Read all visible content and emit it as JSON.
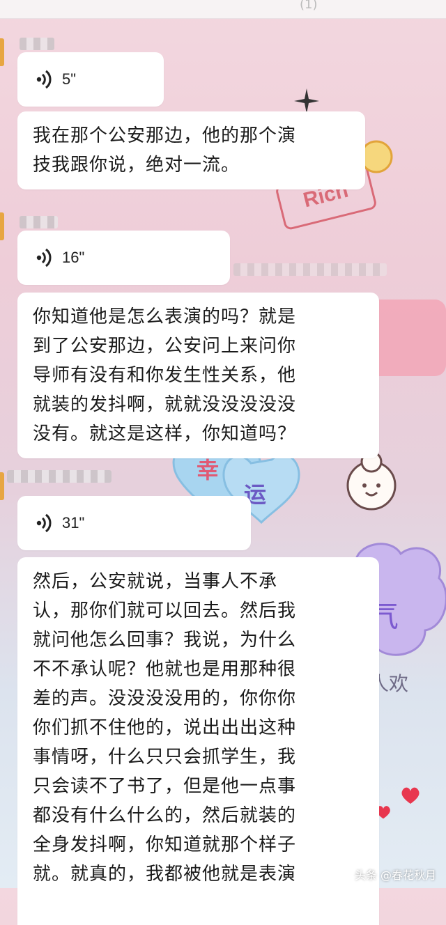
{
  "header": {
    "title": "(1)"
  },
  "messages": [
    {
      "type": "voice",
      "duration": "5\""
    },
    {
      "type": "text",
      "lines": [
        "我在那个公安那边，他的那个演",
        "技我跟你说，绝对一流。"
      ]
    },
    {
      "type": "voice",
      "duration": "16\""
    },
    {
      "type": "text",
      "lines": [
        "你知道他是怎么表演的吗？就是",
        "到了公安那边，公安问上来问你",
        "导师有没有和你发生性关系，他",
        "就装的发抖啊，就就没没没没没",
        "没有。就这是这样，你知道吗？"
      ]
    },
    {
      "type": "voice",
      "duration": "31\""
    },
    {
      "type": "text",
      "lines": [
        "然后，公安就说，当事人不承",
        "认，那你们就可以回去。然后我",
        "就问他怎么回事？我说，为什么",
        "不不承认呢？他就也是用那种很",
        "差的声。没没没没用的，你你你",
        "你们抓不住他的，说出出出这种",
        "事情呀，什么只只会抓学生，我",
        "只会读不了书了，但是他一点事",
        "都没有什么什么的，然后就装的",
        "全身发抖啊，你知道就那个样子",
        "就。就真的，我都被他就是表演"
      ]
    }
  ],
  "wallpaper": {
    "sticker_rich": "Rich",
    "heart_text_1": "幸",
    "heart_text_2": "运",
    "cloud_text": "气",
    "side_text": "人欢"
  },
  "watermark": "头条 @春花秋月",
  "colors": {
    "bubble": "#ffffff",
    "background_top": "#f3d7df",
    "background_bottom": "#e3ecf4"
  }
}
